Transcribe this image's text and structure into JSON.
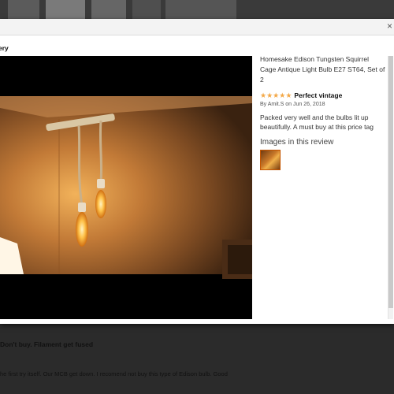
{
  "modal": {
    "close_icon": "×",
    "gallery_title": "ery"
  },
  "review": {
    "product_title": "Homesake Edison Tungsten Squirrel Cage Antique Light Bulb E27 ST64, Set of 2",
    "rating": 5,
    "star_glyph": "★",
    "title": "Perfect vintage",
    "byline": "By Amit.S on Jun 26, 2018",
    "body": "Packed very well and the bulbs lit up beautifully. A must buy at this price tag",
    "images_heading": "Images in this review"
  },
  "background": {
    "review_title": "Don't buy. Filament get fused",
    "review_body": "he first try itself. Our MCB get down. I recomend not buy this type of Edison bulb. Good"
  },
  "colors": {
    "star": "#f3a847",
    "thumb_border": "#c45500",
    "overlay": "#2b2b2b"
  }
}
